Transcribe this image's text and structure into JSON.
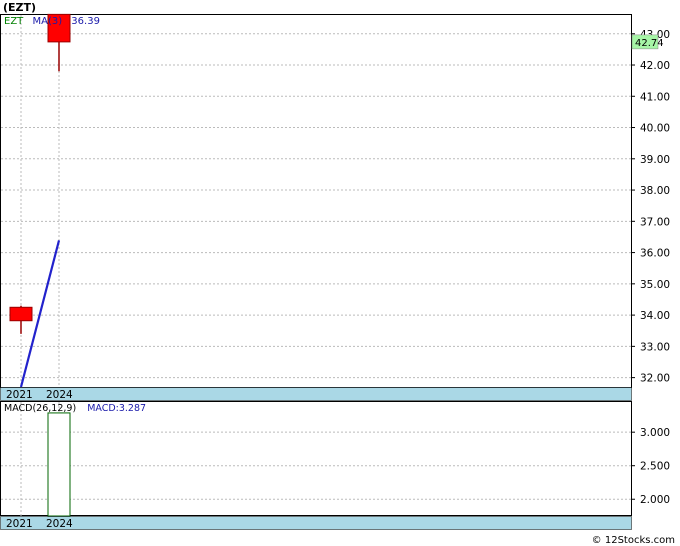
{
  "title": "(EZT)",
  "watermark": "© 12Stocks.com",
  "colors": {
    "candle_fill": "#ff0000",
    "candle_stroke": "#990000",
    "ma_line": "#2222cc",
    "macd_bar_stroke": "#006600",
    "grid": "#bbbbbb",
    "axis_band": "#aad8e6",
    "last_price_bg": "#a6f5a6",
    "ticker_label": "#008000",
    "ma_label": "#1a1aaa"
  },
  "price_panel": {
    "ticker_label": "EZT",
    "ma_label": "MA(3)",
    "ma_value": "36.39",
    "last_price": "42.74",
    "x_labels": [
      "2021",
      "2024"
    ]
  },
  "macd_panel": {
    "label": "MACD(26,12,9)",
    "value_label": "MACD:3.287",
    "x_labels": [
      "2021",
      "2024"
    ]
  },
  "chart_data": [
    {
      "type": "candlestick",
      "x": [
        "2021",
        "2024"
      ],
      "ohlc": [
        {
          "x": "2021",
          "open": 34.25,
          "high": 34.3,
          "low": 33.4,
          "close": 33.82
        },
        {
          "x": "2024",
          "open": 42.74,
          "high": 43.6,
          "low": 41.8,
          "close": 43.62
        }
      ],
      "series": [
        {
          "name": "MA(3)",
          "values": [
            31.7,
            36.39
          ]
        }
      ],
      "ylim": [
        31.7,
        43.6
      ],
      "y_ticks": [
        "32.00",
        "33.00",
        "34.00",
        "35.00",
        "36.00",
        "37.00",
        "38.00",
        "39.00",
        "40.00",
        "41.00",
        "42.00",
        "43.00"
      ],
      "grid": true,
      "last_price": 42.74
    },
    {
      "type": "bar",
      "categories": [
        "2024"
      ],
      "series": [
        {
          "name": "MACD(26,12,9)",
          "values": [
            3.287
          ]
        }
      ],
      "ylim": [
        1.75,
        3.45
      ],
      "y_ticks": [
        "2.000",
        "2.500",
        "3.000"
      ],
      "grid": true
    }
  ]
}
